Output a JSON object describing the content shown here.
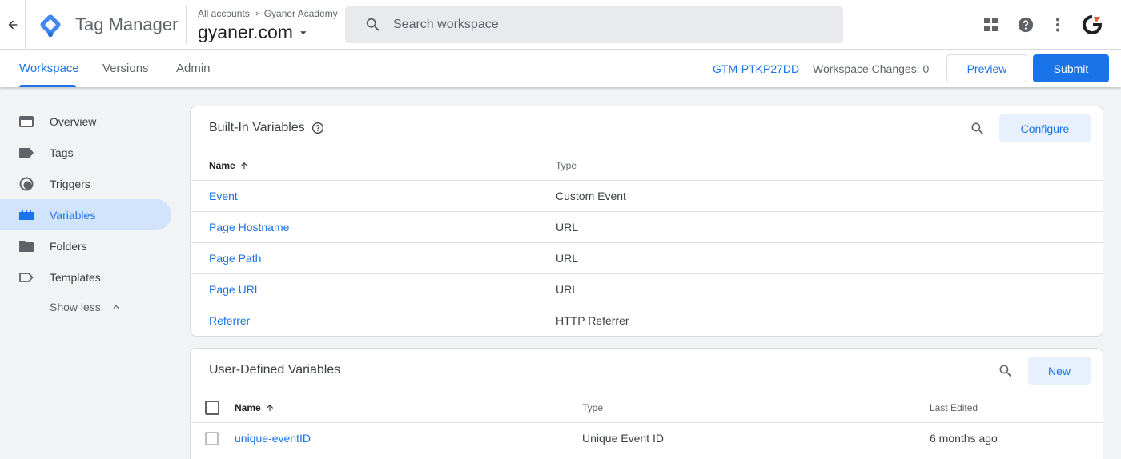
{
  "app": {
    "product_name": "Tag Manager"
  },
  "header": {
    "breadcrumb_account": "All accounts",
    "breadcrumb_sub": "Gyaner Academy",
    "container_name": "gyaner.com",
    "search_placeholder": "Search workspace"
  },
  "tabs": [
    {
      "label": "Workspace",
      "active": true
    },
    {
      "label": "Versions"
    },
    {
      "label": "Admin"
    }
  ],
  "toolbar": {
    "container_id": "GTM-PTKP27DD",
    "workspace_changes": "Workspace Changes: 0",
    "preview_label": "Preview",
    "submit_label": "Submit"
  },
  "sidebar": {
    "items": [
      {
        "label": "Overview",
        "icon": "overview-icon"
      },
      {
        "label": "Tags",
        "icon": "tag-icon"
      },
      {
        "label": "Triggers",
        "icon": "trigger-icon"
      },
      {
        "label": "Variables",
        "icon": "variables-icon",
        "active": true
      },
      {
        "label": "Folders",
        "icon": "folder-icon"
      },
      {
        "label": "Templates",
        "icon": "template-icon"
      }
    ],
    "show_less": "Show less"
  },
  "builtin": {
    "title": "Built-In Variables",
    "configure_label": "Configure",
    "columns": [
      "Name",
      "Type"
    ],
    "rows": [
      {
        "name": "Event",
        "type": "Custom Event"
      },
      {
        "name": "Page Hostname",
        "type": "URL"
      },
      {
        "name": "Page Path",
        "type": "URL"
      },
      {
        "name": "Page URL",
        "type": "URL"
      },
      {
        "name": "Referrer",
        "type": "HTTP Referrer"
      }
    ]
  },
  "userdefined": {
    "title": "User-Defined Variables",
    "new_label": "New",
    "columns": [
      "Name",
      "Type",
      "Last Edited"
    ],
    "rows": [
      {
        "name": "unique-eventID",
        "type": "Unique Event ID",
        "edited": "6 months ago"
      }
    ]
  },
  "colors": {
    "accent": "#1a73e8",
    "nav_active_bg": "#d2e3fc",
    "page_bg": "#f1f3f4"
  }
}
